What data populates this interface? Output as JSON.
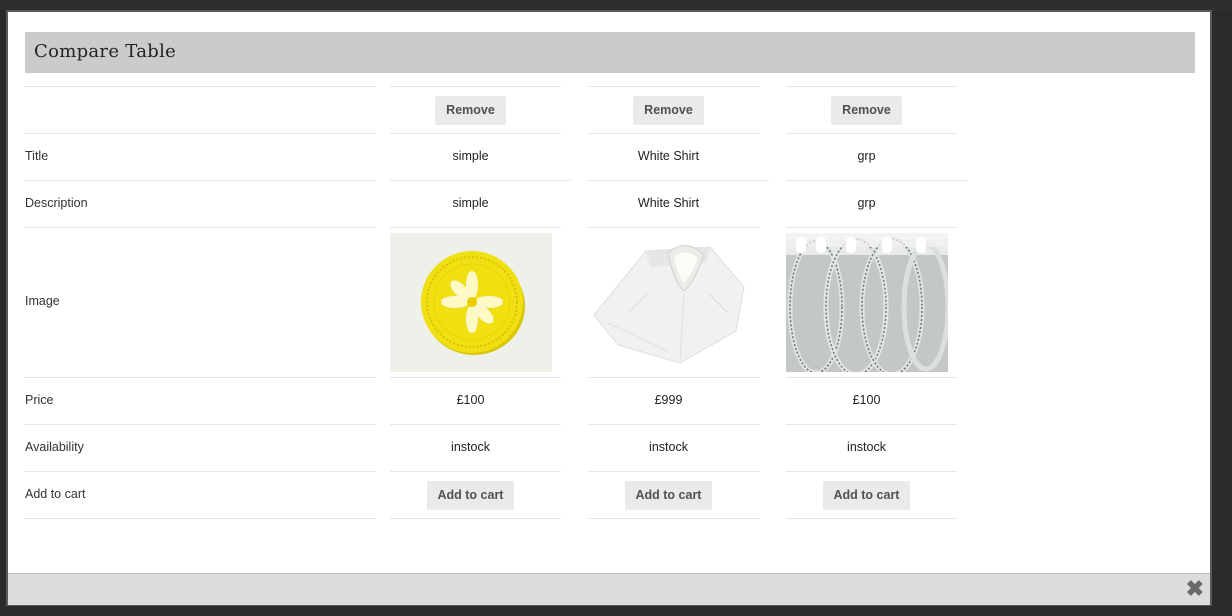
{
  "modal": {
    "title": "Compare Table",
    "close_icon": "close-icon"
  },
  "rows": {
    "title_label": "Title",
    "description_label": "Description",
    "image_label": "Image",
    "price_label": "Price",
    "availability_label": "Availability",
    "add_to_cart_label": "Add to cart"
  },
  "products": [
    {
      "remove_label": "Remove",
      "title": "simple",
      "description": "simple",
      "image": "yellow-coin-image",
      "price": "£100",
      "availability": "instock",
      "cart_label": "Add to cart"
    },
    {
      "remove_label": "Remove",
      "title": "White Shirt",
      "description": "White Shirt",
      "image": "white-shirt-image",
      "price": "£999",
      "availability": "instock",
      "cart_label": "Add to cart"
    },
    {
      "remove_label": "Remove",
      "title": "grp",
      "description": "grp",
      "image": "silver-bangles-image",
      "price": "£100",
      "availability": "instock",
      "cart_label": "Add to cart"
    }
  ]
}
